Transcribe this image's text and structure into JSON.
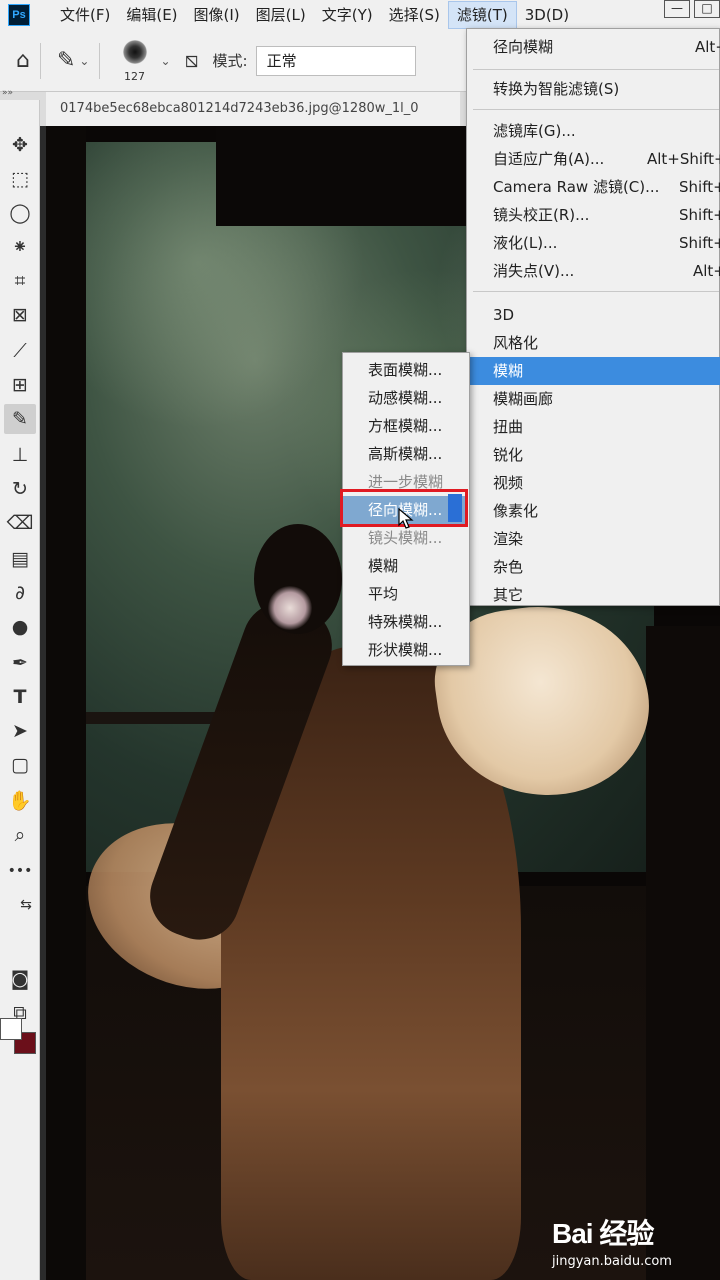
{
  "app": {
    "logo": "Ps"
  },
  "menubar": {
    "items": [
      {
        "label": "文件(F)"
      },
      {
        "label": "编辑(E)"
      },
      {
        "label": "图像(I)"
      },
      {
        "label": "图层(L)"
      },
      {
        "label": "文字(Y)"
      },
      {
        "label": "选择(S)"
      },
      {
        "label": "滤镜(T)"
      },
      {
        "label": "3D(D)"
      }
    ],
    "window_buttons": {
      "minimize": "—",
      "restore": "□"
    }
  },
  "options": {
    "brush_size": "127",
    "mode_label": "模式:",
    "mode_value": "正常"
  },
  "document": {
    "collapse_mark": "»»",
    "tab_title": "0174be5ec68ebca801214d7243eb36.jpg@1280w_1l_0"
  },
  "toolbar": {
    "tools": [
      {
        "name": "move-tool",
        "glyph": "✥"
      },
      {
        "name": "marquee-tool",
        "glyph": "⬚"
      },
      {
        "name": "lasso-tool",
        "glyph": "◯"
      },
      {
        "name": "quick-select-tool",
        "glyph": "⁕"
      },
      {
        "name": "crop-tool",
        "glyph": "⌗"
      },
      {
        "name": "frame-tool",
        "glyph": "⊠"
      },
      {
        "name": "eyedropper-tool",
        "glyph": "⟋"
      },
      {
        "name": "healing-tool",
        "glyph": "⊞"
      },
      {
        "name": "brush-tool",
        "glyph": "✎"
      },
      {
        "name": "stamp-tool",
        "glyph": "⊥"
      },
      {
        "name": "history-brush-tool",
        "glyph": "↻"
      },
      {
        "name": "eraser-tool",
        "glyph": "⌫"
      },
      {
        "name": "gradient-tool",
        "glyph": "▤"
      },
      {
        "name": "blur-tool",
        "glyph": "∂"
      },
      {
        "name": "dodge-tool",
        "glyph": "●"
      },
      {
        "name": "pen-tool",
        "glyph": "✒"
      },
      {
        "name": "type-tool",
        "glyph": "T"
      },
      {
        "name": "path-select-tool",
        "glyph": "➤"
      },
      {
        "name": "shape-tool",
        "glyph": "▢"
      },
      {
        "name": "hand-tool",
        "glyph": "✋"
      },
      {
        "name": "zoom-tool",
        "glyph": "⌕"
      },
      {
        "name": "more-tools",
        "glyph": "•••"
      }
    ],
    "swap_glyph": "⇆",
    "quickmask_glyph": "◙",
    "screenmode_glyph": "⧉"
  },
  "filter_menu": {
    "items": [
      {
        "label": "径向模糊",
        "shortcut": "Alt+"
      },
      {
        "label": "转换为智能滤镜(S)",
        "shortcut": ""
      },
      {
        "label": "滤镜库(G)...",
        "shortcut": ""
      },
      {
        "label": "自适应广角(A)...",
        "shortcut": "Alt+Shift+"
      },
      {
        "label": "Camera Raw 滤镜(C)...",
        "shortcut": "Shift+"
      },
      {
        "label": "镜头校正(R)...",
        "shortcut": "Shift+"
      },
      {
        "label": "液化(L)...",
        "shortcut": "Shift+"
      },
      {
        "label": "消失点(V)...",
        "shortcut": "Alt+"
      },
      {
        "label": "3D",
        "shortcut": ""
      },
      {
        "label": "风格化",
        "shortcut": ""
      },
      {
        "label": "模糊",
        "shortcut": ""
      },
      {
        "label": "模糊画廊",
        "shortcut": ""
      },
      {
        "label": "扭曲",
        "shortcut": ""
      },
      {
        "label": "锐化",
        "shortcut": ""
      },
      {
        "label": "视频",
        "shortcut": ""
      },
      {
        "label": "像素化",
        "shortcut": ""
      },
      {
        "label": "渲染",
        "shortcut": ""
      },
      {
        "label": "杂色",
        "shortcut": ""
      },
      {
        "label": "其它",
        "shortcut": ""
      }
    ]
  },
  "blur_submenu": {
    "items": [
      {
        "label": "表面模糊..."
      },
      {
        "label": "动感模糊..."
      },
      {
        "label": "方框模糊..."
      },
      {
        "label": "高斯模糊..."
      },
      {
        "label": "进一步模糊"
      },
      {
        "label": "径向模糊..."
      },
      {
        "label": "镜头模糊..."
      },
      {
        "label": "模糊"
      },
      {
        "label": "平均"
      },
      {
        "label": "特殊模糊..."
      },
      {
        "label": "形状模糊..."
      }
    ]
  },
  "watermark": {
    "logo": "Bai 经验",
    "url": "jingyan.baidu.com"
  },
  "colors": {
    "highlight": "#3c8cdf",
    "annotation_red": "#e01a22",
    "background_swatch": "#6b0f1a",
    "foreground_swatch": "#ffffff"
  }
}
